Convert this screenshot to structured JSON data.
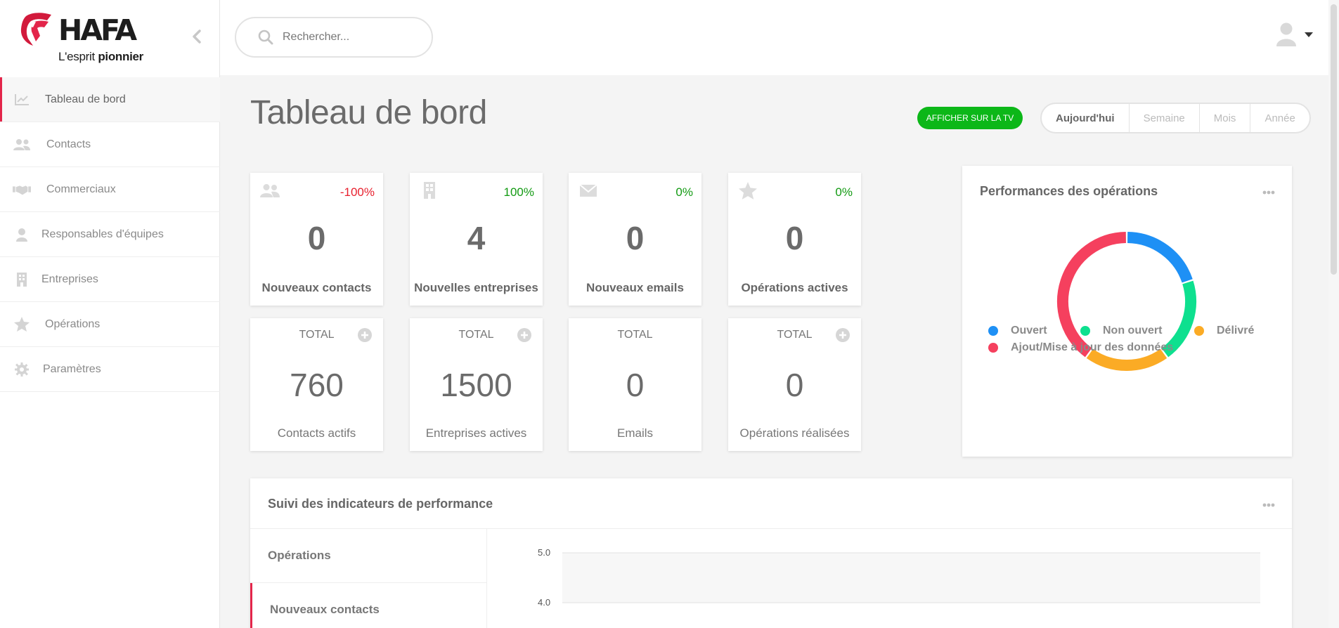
{
  "brand": {
    "name": "HAFA",
    "tagline_light": "L'esprit",
    "tagline_bold": "pionnier"
  },
  "sidebar": {
    "items": [
      {
        "label": "Tableau de bord",
        "icon": "chart-icon",
        "active": true
      },
      {
        "label": "Contacts",
        "icon": "users-icon"
      },
      {
        "label": "Commerciaux",
        "icon": "handshake-icon"
      },
      {
        "label": "Responsables d'équipes",
        "icon": "user-icon"
      },
      {
        "label": "Entreprises",
        "icon": "building-icon"
      },
      {
        "label": "Opérations",
        "icon": "star-icon"
      },
      {
        "label": "Paramètres",
        "icon": "gear-icon"
      }
    ]
  },
  "header": {
    "search_placeholder": "Rechercher..."
  },
  "page": {
    "title": "Tableau de bord",
    "tv_button": "AFFICHER SUR LA TV",
    "periods": [
      "Aujourd'hui",
      "Semaine",
      "Mois",
      "Année"
    ],
    "selected_period": "Aujourd'hui"
  },
  "stats": [
    {
      "icon": "users-icon",
      "pct": "-100%",
      "pct_color": "#e8202e",
      "value": "0",
      "label": "Nouveaux contacts"
    },
    {
      "icon": "building-icon",
      "pct": "100%",
      "pct_color": "#129a12",
      "value": "4",
      "label": "Nouvelles entreprises"
    },
    {
      "icon": "envelope-icon",
      "pct": "0%",
      "pct_color": "#129a12",
      "value": "0",
      "label": "Nouveaux emails"
    },
    {
      "icon": "star-icon",
      "pct": "0%",
      "pct_color": "#129a12",
      "value": "0",
      "label": "Opérations actives"
    }
  ],
  "totals": [
    {
      "label": "TOTAL",
      "value": "760",
      "sub": "Contacts actifs",
      "has_add": true
    },
    {
      "label": "TOTAL",
      "value": "1500",
      "sub": "Entreprises actives",
      "has_add": true
    },
    {
      "label": "TOTAL",
      "value": "0",
      "sub": "Emails",
      "has_add": false
    },
    {
      "label": "TOTAL",
      "value": "0",
      "sub": "Opérations réalisées",
      "has_add": true
    }
  ],
  "performance": {
    "title": "Performances des opérations",
    "legend": [
      {
        "label": "Ouvert",
        "color": "#1e90f5"
      },
      {
        "label": "Non ouvert",
        "color": "#0ee08f"
      },
      {
        "label": "Délivré",
        "color": "#fbab25"
      },
      {
        "label": "Ajout/Mise à jour des données",
        "color": "#f5405e"
      }
    ]
  },
  "chart_data": {
    "type": "pie",
    "title": "Performances des opérations",
    "categories": [
      "Ouvert",
      "Non ouvert",
      "Délivré",
      "Ajout/Mise à jour des données"
    ],
    "values": [
      1,
      1,
      1,
      2
    ],
    "colors": [
      "#1e90f5",
      "#0ee08f",
      "#fbab25",
      "#f5405e"
    ],
    "legend": "left"
  },
  "kpi": {
    "title": "Suivi des indicateurs de performance",
    "tabs": [
      {
        "label": "Opérations",
        "active": false
      },
      {
        "label": "Nouveaux contacts",
        "active": true
      }
    ],
    "y_ticks": [
      "5.0",
      "4.0"
    ]
  }
}
